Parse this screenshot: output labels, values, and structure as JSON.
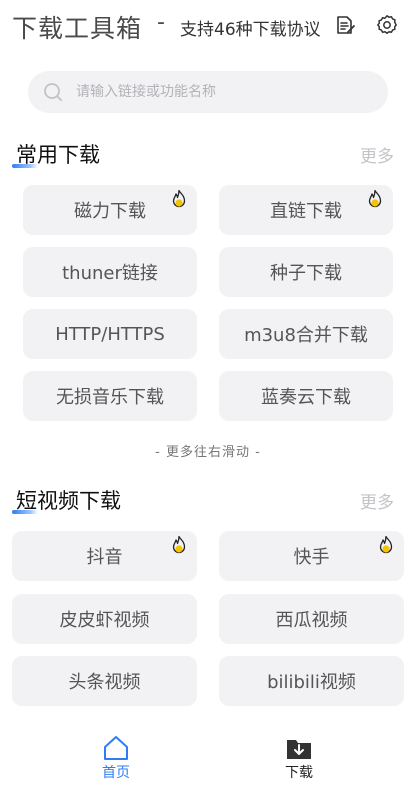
{
  "header": {
    "title": "下载工具箱",
    "separator": "-",
    "subtitle": "支持46种下载协议",
    "icons": [
      "notes-icon",
      "gear-icon"
    ]
  },
  "search": {
    "placeholder": "请输入链接或功能名称"
  },
  "sections": [
    {
      "title": "常用下载",
      "more": "更多",
      "items": [
        {
          "label": "磁力下载",
          "hot": true
        },
        {
          "label": "直链下载",
          "hot": true
        },
        {
          "label": "thuner链接",
          "hot": false
        },
        {
          "label": "种子下载",
          "hot": false
        },
        {
          "label": "HTTP/HTTPS",
          "hot": false
        },
        {
          "label": "m3u8合并下载",
          "hot": false
        },
        {
          "label": "无损音乐下载",
          "hot": false
        },
        {
          "label": "蓝奏云下载",
          "hot": false
        }
      ],
      "hint": "- 更多往右滑动 -"
    },
    {
      "title": "短视频下载",
      "more": "更多",
      "items": [
        {
          "label": "抖音",
          "hot": true
        },
        {
          "label": "快手",
          "hot": true
        },
        {
          "label": "皮皮虾视频",
          "hot": false
        },
        {
          "label": "西瓜视频",
          "hot": false
        },
        {
          "label": "头条视频",
          "hot": false
        },
        {
          "label": "bilibili视频",
          "hot": false
        }
      ]
    }
  ],
  "tabbar": {
    "tabs": [
      {
        "label": "首页",
        "icon": "home-icon",
        "active": true
      },
      {
        "label": "下载",
        "icon": "download-folder-icon",
        "active": false
      }
    ]
  },
  "colors": {
    "accent": "#2f7df6",
    "chip_bg": "#f2f2f4",
    "hot_badge": "#f5c400"
  }
}
